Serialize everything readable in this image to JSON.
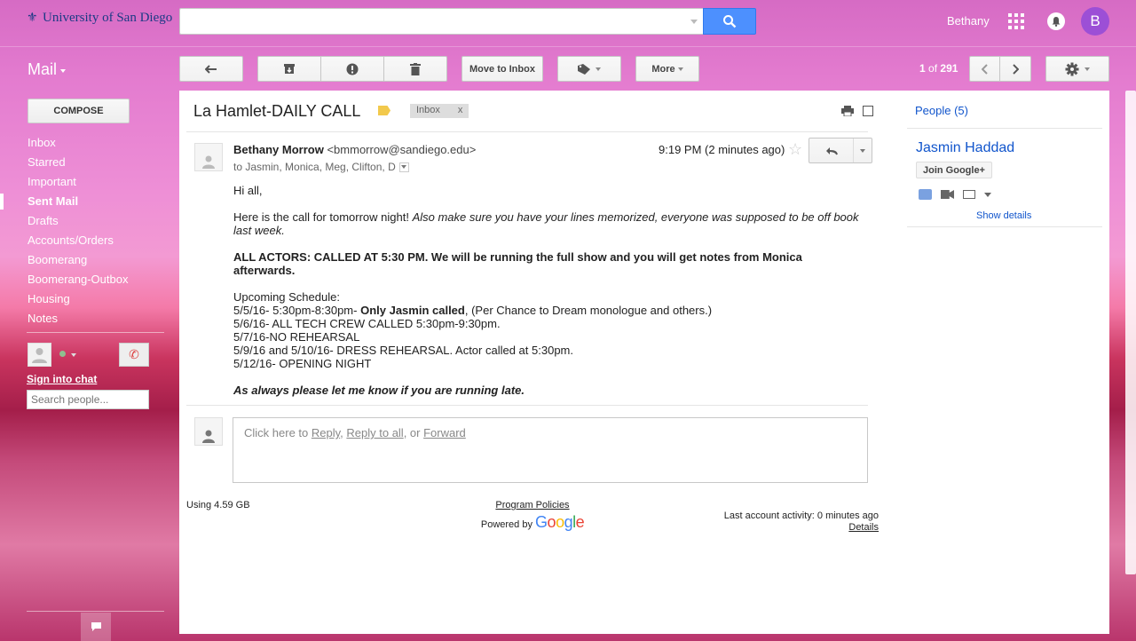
{
  "header": {
    "logo_text": "University of San Diego",
    "search": {
      "value": "",
      "placeholder": ""
    },
    "user_name": "Bethany",
    "avatar_initial": "B"
  },
  "app_label": "Mail",
  "toolbar": {
    "move_to_inbox": "Move to Inbox",
    "more": "More",
    "page_current": "1",
    "page_of": "of",
    "page_total": "291"
  },
  "sidebar": {
    "compose": "COMPOSE",
    "items": [
      {
        "label": "Inbox",
        "bold": false
      },
      {
        "label": "Starred",
        "bold": false
      },
      {
        "label": "Important",
        "bold": false
      },
      {
        "label": "Sent Mail",
        "bold": true
      },
      {
        "label": "Drafts",
        "bold": false
      },
      {
        "label": "Accounts/Orders",
        "bold": false
      },
      {
        "label": "Boomerang",
        "bold": false
      },
      {
        "label": "Boomerang-Outbox",
        "bold": false
      },
      {
        "label": "Housing",
        "bold": false
      },
      {
        "label": "Notes",
        "bold": false
      }
    ],
    "sign_into_chat": "Sign into chat",
    "search_people_placeholder": "Search people..."
  },
  "email": {
    "subject": "La Hamlet-DAILY CALL",
    "label_chip": "Inbox",
    "label_chip_close": "x",
    "sender_name": "Bethany Morrow",
    "sender_email": "<bmmorrow@sandiego.edu>",
    "recipients": "to Jasmin, Monica, Meg, Clifton, D",
    "time": "9:19 PM (2 minutes ago)",
    "body": {
      "greeting": "Hi all,",
      "intro_plain": "Here is the call for tomorrow night! ",
      "intro_italic": "Also make sure you have your lines memorized, everyone was supposed to be off book last week.",
      "actors_call": "ALL ACTORS: CALLED AT 5:30 PM. We will be running the full show and you will get notes from Monica afterwards.",
      "schedule_title": "Upcoming Schedule:",
      "schedule_1_a": "5/5/16- 5:30pm-8:30pm- ",
      "schedule_1_b": "Only Jasmin called",
      "schedule_1_c": ", (Per Chance to Dream monologue and others.)",
      "schedule_2": "5/6/16- ALL TECH CREW CALLED 5:30pm-9:30pm.",
      "schedule_3": "5/7/16-NO REHEARSAL",
      "schedule_4": "5/9/16 and 5/10/16- DRESS REHEARSAL. Actor called at 5:30pm.",
      "schedule_5": "5/12/16- OPENING NIGHT",
      "closing": "As always please let me know if you are running late."
    },
    "reply_prompt": {
      "prefix": "Click here to ",
      "reply": "Reply",
      "sep1": ", ",
      "reply_all": "Reply to all",
      "sep2": ", or ",
      "forward": "Forward"
    }
  },
  "footer": {
    "storage": "Using 4.59 GB",
    "program_policies": "Program Policies",
    "powered_by": "Powered by ",
    "google": "Google",
    "last_activity": "Last account activity: 0 minutes ago",
    "details": "Details"
  },
  "people": {
    "title": "People (5)",
    "contact_name": "Jasmin Haddad",
    "join_button": "Join Google+",
    "show_details": "Show details"
  },
  "colors": {
    "accent_blue": "#4d90fe",
    "link_blue": "#1155cc",
    "avatar_purple": "#9c4fd6",
    "label_yellow": "#f2c94c"
  }
}
